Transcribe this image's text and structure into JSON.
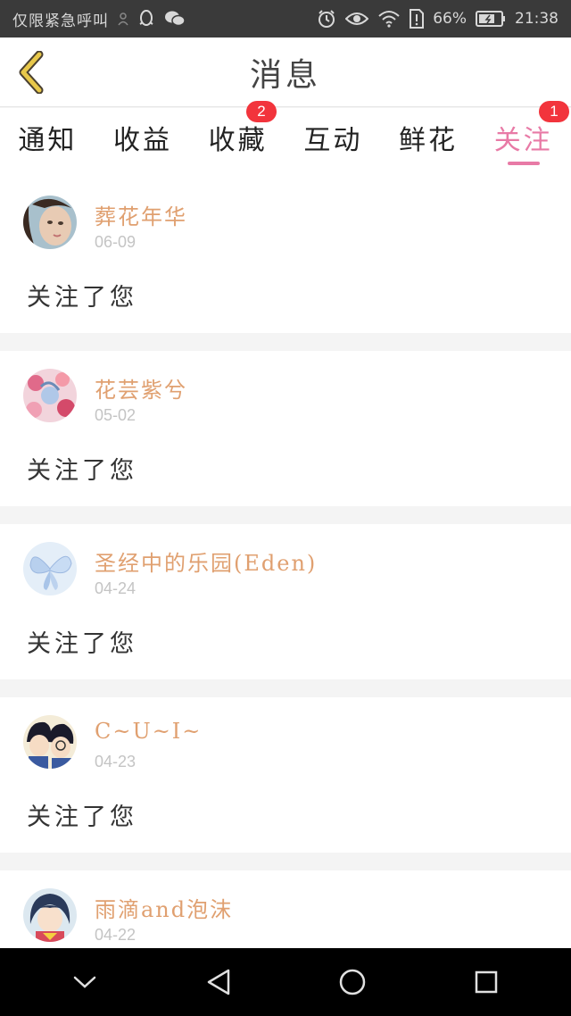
{
  "status_bar": {
    "carrier": "仅限紧急呼叫",
    "battery": "66%",
    "time": "21:38"
  },
  "header": {
    "title": "消息"
  },
  "tabs": [
    {
      "label": "通知",
      "badge": ""
    },
    {
      "label": "收益",
      "badge": ""
    },
    {
      "label": "收藏",
      "badge": "2"
    },
    {
      "label": "互动",
      "badge": ""
    },
    {
      "label": "鲜花",
      "badge": ""
    },
    {
      "label": "关注",
      "badge": "1"
    }
  ],
  "active_tab": "关注",
  "messages": [
    {
      "name": "葬花年华",
      "date": "06-09",
      "text": "关注了您"
    },
    {
      "name": "花芸紫兮",
      "date": "05-02",
      "text": "关注了您"
    },
    {
      "name": "圣经中的乐园(Eden)",
      "date": "04-24",
      "text": "关注了您"
    },
    {
      "name": "C~U~I~",
      "date": "04-23",
      "text": "关注了您"
    },
    {
      "name": "雨滴and泡沫",
      "date": "04-22",
      "text": ""
    }
  ],
  "colors": {
    "accent": "#e87aa6",
    "username": "#e0a070",
    "badge": "#f2343c",
    "back_arrow": "#e8c84a"
  }
}
